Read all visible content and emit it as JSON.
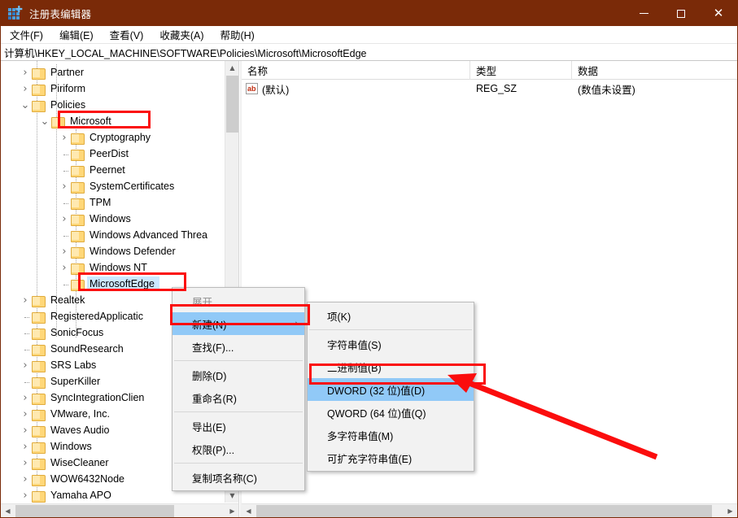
{
  "window": {
    "title": "注册表编辑器",
    "icon": "registry-icon",
    "controls": {
      "minimize": "–",
      "maximize": "□",
      "close": "✕"
    },
    "titlebar_color": "#7a2a08"
  },
  "menubar": {
    "items": [
      {
        "label": "文件(F)"
      },
      {
        "label": "编辑(E)"
      },
      {
        "label": "查看(V)"
      },
      {
        "label": "收藏夹(A)"
      },
      {
        "label": "帮助(H)"
      }
    ]
  },
  "address": {
    "path": "计算机\\HKEY_LOCAL_MACHINE\\SOFTWARE\\Policies\\Microsoft\\MicrosoftEdge"
  },
  "tree": {
    "nodes": [
      {
        "label": "Partner",
        "indent": 1,
        "state": "collapsed",
        "selected": false
      },
      {
        "label": "Piriform",
        "indent": 1,
        "state": "collapsed",
        "selected": false
      },
      {
        "label": "Policies",
        "indent": 1,
        "state": "expanded",
        "selected": false
      },
      {
        "label": "Microsoft",
        "indent": 2,
        "state": "expanded",
        "selected": false
      },
      {
        "label": "Cryptography",
        "indent": 3,
        "state": "collapsed",
        "selected": false
      },
      {
        "label": "PeerDist",
        "indent": 3,
        "state": "leaf",
        "selected": false
      },
      {
        "label": "Peernet",
        "indent": 3,
        "state": "leaf",
        "selected": false
      },
      {
        "label": "SystemCertificates",
        "indent": 3,
        "state": "collapsed",
        "selected": false
      },
      {
        "label": "TPM",
        "indent": 3,
        "state": "leaf",
        "selected": false
      },
      {
        "label": "Windows",
        "indent": 3,
        "state": "collapsed",
        "selected": false
      },
      {
        "label": "Windows Advanced Threa",
        "indent": 3,
        "state": "leaf",
        "selected": false
      },
      {
        "label": "Windows Defender",
        "indent": 3,
        "state": "collapsed",
        "selected": false
      },
      {
        "label": "Windows NT",
        "indent": 3,
        "state": "collapsed",
        "selected": false
      },
      {
        "label": "MicrosoftEdge",
        "indent": 3,
        "state": "leaf",
        "selected": true
      },
      {
        "label": "Realtek",
        "indent": 1,
        "state": "collapsed",
        "selected": false
      },
      {
        "label": "RegisteredApplicatic",
        "indent": 1,
        "state": "leaf",
        "selected": false
      },
      {
        "label": "SonicFocus",
        "indent": 1,
        "state": "leaf",
        "selected": false
      },
      {
        "label": "SoundResearch",
        "indent": 1,
        "state": "leaf",
        "selected": false
      },
      {
        "label": "SRS Labs",
        "indent": 1,
        "state": "collapsed",
        "selected": false
      },
      {
        "label": "SuperKiller",
        "indent": 1,
        "state": "leaf",
        "selected": false
      },
      {
        "label": "SyncIntegrationClien",
        "indent": 1,
        "state": "collapsed",
        "selected": false
      },
      {
        "label": "VMware, Inc.",
        "indent": 1,
        "state": "collapsed",
        "selected": false
      },
      {
        "label": "Waves Audio",
        "indent": 1,
        "state": "collapsed",
        "selected": false
      },
      {
        "label": "Windows",
        "indent": 1,
        "state": "collapsed",
        "selected": false
      },
      {
        "label": "WiseCleaner",
        "indent": 1,
        "state": "collapsed",
        "selected": false
      },
      {
        "label": "WOW6432Node",
        "indent": 1,
        "state": "collapsed",
        "selected": false
      },
      {
        "label": "Yamaha APO",
        "indent": 1,
        "state": "collapsed",
        "selected": false
      }
    ]
  },
  "values": {
    "columns": [
      "名称",
      "类型",
      "数据"
    ],
    "rows": [
      {
        "name": "(默认)",
        "type": "REG_SZ",
        "data": "(数值未设置)",
        "icon": "string-value-icon"
      }
    ]
  },
  "context_menu": {
    "items": [
      {
        "label": "展开",
        "highlighted": false,
        "disabled": true,
        "submenu": false,
        "separator_after": false
      },
      {
        "label": "新建(N)",
        "highlighted": true,
        "disabled": false,
        "submenu": true,
        "separator_after": false
      },
      {
        "label": "查找(F)...",
        "highlighted": false,
        "disabled": false,
        "submenu": false,
        "separator_after": true
      },
      {
        "label": "删除(D)",
        "highlighted": false,
        "disabled": false,
        "submenu": false,
        "separator_after": false
      },
      {
        "label": "重命名(R)",
        "highlighted": false,
        "disabled": false,
        "submenu": false,
        "separator_after": true
      },
      {
        "label": "导出(E)",
        "highlighted": false,
        "disabled": false,
        "submenu": false,
        "separator_after": false
      },
      {
        "label": "权限(P)...",
        "highlighted": false,
        "disabled": false,
        "submenu": false,
        "separator_after": true
      },
      {
        "label": "复制项名称(C)",
        "highlighted": false,
        "disabled": false,
        "submenu": false,
        "separator_after": false
      }
    ]
  },
  "submenu": {
    "items": [
      {
        "label": "项(K)",
        "highlighted": false,
        "separator_after": true
      },
      {
        "label": "字符串值(S)",
        "highlighted": false,
        "separator_after": false
      },
      {
        "label": "二进制值(B)",
        "highlighted": false,
        "separator_after": false
      },
      {
        "label": "DWORD (32 位)值(D)",
        "highlighted": true,
        "separator_after": false
      },
      {
        "label": "QWORD (64 位)值(Q)",
        "highlighted": false,
        "separator_after": false
      },
      {
        "label": "多字符串值(M)",
        "highlighted": false,
        "separator_after": false
      },
      {
        "label": "可扩充字符串值(E)",
        "highlighted": false,
        "separator_after": false
      }
    ]
  },
  "annotations": {
    "highlight_color": "#fb0d0d",
    "boxes": [
      "microsoft-key",
      "microsoftedge-key",
      "new-menu-item",
      "dword-submenu-item"
    ],
    "arrow": "points-to-dword-item"
  },
  "icons": {
    "chevron_expanded": "⌄",
    "chevron_collapsed": "›",
    "scroll_up": "⌃",
    "scroll_down": "⌄",
    "scroll_left": "‹",
    "scroll_right": "›",
    "submenu_arrow": "›"
  }
}
